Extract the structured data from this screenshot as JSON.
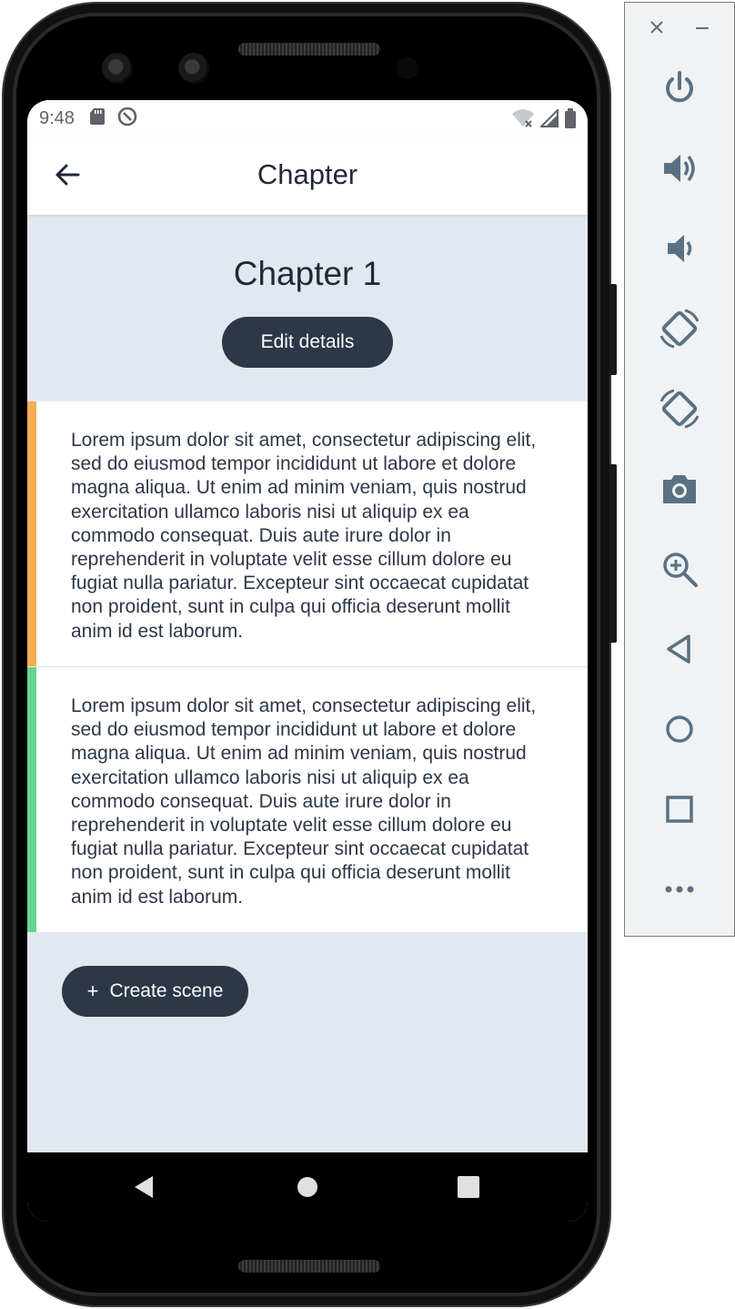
{
  "status_bar": {
    "time": "9:48"
  },
  "app_bar": {
    "title": "Chapter"
  },
  "chapter": {
    "title": "Chapter 1",
    "edit_button": "Edit details"
  },
  "scenes": [
    {
      "text": "Lorem ipsum dolor sit amet, consectetur adipiscing elit, sed do eiusmod tempor incididunt ut labore et dolore magna aliqua. Ut enim ad minim veniam, quis nostrud exercitation ullamco laboris nisi ut aliquip ex ea commodo consequat. Duis aute irure dolor in reprehenderit in voluptate velit esse cillum dolore eu fugiat nulla pariatur. Excepteur sint occaecat cupidatat non proident, sunt in culpa qui officia deserunt mollit anim id est laborum.",
      "accent_color": "#f6ad55"
    },
    {
      "text": "Lorem ipsum dolor sit amet, consectetur adipiscing elit, sed do eiusmod tempor incididunt ut labore et dolore magna aliqua. Ut enim ad minim veniam, quis nostrud exercitation ullamco laboris nisi ut aliquip ex ea commodo consequat. Duis aute irure dolor in reprehenderit in voluptate velit esse cillum dolore eu fugiat nulla pariatur. Excepteur sint occaecat cupidatat non proident, sunt in culpa qui officia deserunt mollit anim id est laborum.",
      "accent_color": "#68d391"
    }
  ],
  "create_scene": {
    "icon": "+",
    "label": "Create scene"
  },
  "colors": {
    "screen_background": "#e2e8f0",
    "button": "#2d3748",
    "text": "#1f2937"
  },
  "emulator_tools": [
    "close-icon",
    "minimize-icon",
    "power-icon",
    "volume-up-icon",
    "volume-down-icon",
    "rotate-left-icon",
    "rotate-right-icon",
    "camera-icon",
    "zoom-icon",
    "back-icon",
    "home-icon",
    "overview-icon",
    "more-icon"
  ]
}
